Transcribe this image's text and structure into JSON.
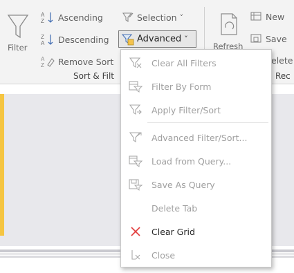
{
  "ribbon": {
    "filter_label": "Filter",
    "ascending_label": "Ascending",
    "descending_label": "Descending",
    "remove_sort_label": "Remove Sort",
    "selection_label": "Selection",
    "selection_arrow": "˅",
    "advanced_label": "Advanced",
    "advanced_arrow": "˅",
    "group_sort_filter": "Sort & Filt",
    "refresh_label": "Refresh",
    "new_label": "New",
    "save_label": "Save",
    "delete_label": "elete",
    "group_records": "Rec"
  },
  "menu": {
    "items": [
      {
        "label": "Clear All Filters",
        "icon": "clear-filters-icon",
        "enabled": false
      },
      {
        "label": "Filter By Form",
        "icon": "filter-by-form-icon",
        "enabled": false
      },
      {
        "label": "Apply Filter/Sort",
        "icon": "apply-filter-icon",
        "enabled": false
      },
      {
        "label": "Advanced Filter/Sort...",
        "icon": "advanced-filter-icon",
        "enabled": false
      },
      {
        "label": "Load from Query...",
        "icon": "load-query-icon",
        "enabled": false
      },
      {
        "label": "Save As Query",
        "icon": "save-query-icon",
        "enabled": false
      },
      {
        "label": "Delete Tab",
        "icon": "",
        "enabled": false
      },
      {
        "label": "Clear Grid",
        "icon": "red-x-icon",
        "enabled": true
      },
      {
        "label": "Close",
        "icon": "close-icon",
        "enabled": false
      }
    ]
  },
  "colors": {
    "accent_yellow": "#f5c542",
    "clear_red": "#e23c3c",
    "ribbon_bg": "#f3f3f3",
    "pane_gray": "#e8e8ec"
  }
}
